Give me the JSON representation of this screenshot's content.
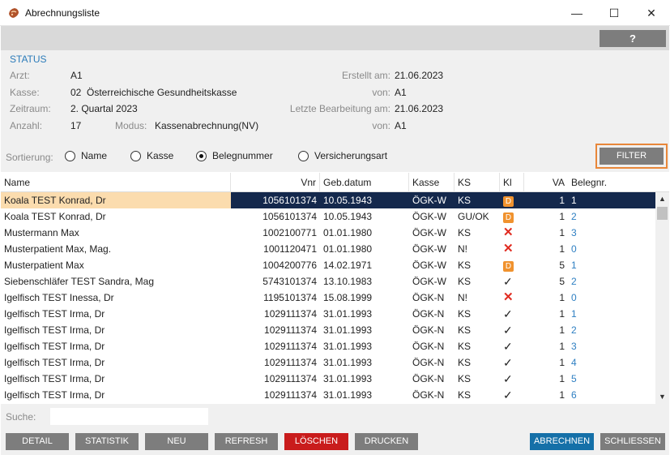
{
  "window": {
    "title": "Abrechnungsliste",
    "minimize": "—",
    "maximize": "☐",
    "close": "✕"
  },
  "help": {
    "label": "?"
  },
  "status": {
    "heading": "STATUS",
    "arzt_label": "Arzt:",
    "arzt_value": "A1",
    "kasse_label": "Kasse:",
    "kasse_value": "02  Österreichische Gesundheitskasse",
    "zeitraum_label": "Zeitraum:",
    "zeitraum_value": "2. Quartal 2023",
    "anzahl_label": "Anzahl:",
    "anzahl_value": "17",
    "modus_label": "Modus:",
    "modus_value": "Kassenabrechnung(NV)",
    "erstellt_label": "Erstellt am:",
    "erstellt_value": "21.06.2023",
    "von1_label": "von:",
    "von1_value": "A1",
    "letzte_label": "Letzte Bearbeitung am:",
    "letzte_value": "21.06.2023",
    "von2_label": "von:",
    "von2_value": "A1"
  },
  "sort": {
    "label": "Sortierung:",
    "options": [
      {
        "label": "Name",
        "selected": false
      },
      {
        "label": "Kasse",
        "selected": false
      },
      {
        "label": "Belegnummer",
        "selected": true
      },
      {
        "label": "Versicherungsart",
        "selected": false
      }
    ],
    "filter_label": "FILTER"
  },
  "table": {
    "headers": {
      "name": "Name",
      "vnr": "Vnr",
      "geb": "Geb.datum",
      "kasse": "Kasse",
      "ks": "KS",
      "kl": "Kl",
      "va": "VA",
      "belegnr": "Belegnr."
    },
    "rows": [
      {
        "name": "Koala TEST Konrad, Dr",
        "vnr": "1056101374",
        "geb": "10.05.1943",
        "kasse": "ÖGK-W",
        "ks": "KS",
        "kl": "badge",
        "va": "1",
        "belegnr": "1",
        "selected": true
      },
      {
        "name": "Koala TEST Konrad, Dr",
        "vnr": "1056101374",
        "geb": "10.05.1943",
        "kasse": "ÖGK-W",
        "ks": "GU/OK",
        "kl": "badge",
        "va": "1",
        "belegnr": "2",
        "selected": false
      },
      {
        "name": "Mustermann Max",
        "vnr": "1002100771",
        "geb": "01.01.1980",
        "kasse": "ÖGK-W",
        "ks": "KS",
        "kl": "x",
        "va": "1",
        "belegnr": "3",
        "selected": false
      },
      {
        "name": "Musterpatient Max, Mag.",
        "vnr": "1001120471",
        "geb": "01.01.1980",
        "kasse": "ÖGK-W",
        "ks": "N!",
        "kl": "x",
        "va": "1",
        "belegnr": "0",
        "selected": false
      },
      {
        "name": "Musterpatient Max",
        "vnr": "1004200776",
        "geb": "14.02.1971",
        "kasse": "ÖGK-W",
        "ks": "KS",
        "kl": "badge",
        "va": "5",
        "belegnr": "1",
        "selected": false
      },
      {
        "name": "Siebenschläfer TEST Sandra, Mag",
        "vnr": "5743101374",
        "geb": "13.10.1983",
        "kasse": "ÖGK-W",
        "ks": "KS",
        "kl": "check",
        "va": "5",
        "belegnr": "2",
        "selected": false
      },
      {
        "name": "Igelfisch TEST Inessa, Dr",
        "vnr": "1195101374",
        "geb": "15.08.1999",
        "kasse": "ÖGK-N",
        "ks": "N!",
        "kl": "x",
        "va": "1",
        "belegnr": "0",
        "selected": false
      },
      {
        "name": "Igelfisch TEST Irma, Dr",
        "vnr": "1029111374",
        "geb": "31.01.1993",
        "kasse": "ÖGK-N",
        "ks": "KS",
        "kl": "check",
        "va": "1",
        "belegnr": "1",
        "selected": false
      },
      {
        "name": "Igelfisch TEST Irma, Dr",
        "vnr": "1029111374",
        "geb": "31.01.1993",
        "kasse": "ÖGK-N",
        "ks": "KS",
        "kl": "check",
        "va": "1",
        "belegnr": "2",
        "selected": false
      },
      {
        "name": "Igelfisch TEST Irma, Dr",
        "vnr": "1029111374",
        "geb": "31.01.1993",
        "kasse": "ÖGK-N",
        "ks": "KS",
        "kl": "check",
        "va": "1",
        "belegnr": "3",
        "selected": false
      },
      {
        "name": "Igelfisch TEST Irma, Dr",
        "vnr": "1029111374",
        "geb": "31.01.1993",
        "kasse": "ÖGK-N",
        "ks": "KS",
        "kl": "check",
        "va": "1",
        "belegnr": "4",
        "selected": false
      },
      {
        "name": "Igelfisch TEST Irma, Dr",
        "vnr": "1029111374",
        "geb": "31.01.1993",
        "kasse": "ÖGK-N",
        "ks": "KS",
        "kl": "check",
        "va": "1",
        "belegnr": "5",
        "selected": false
      },
      {
        "name": "Igelfisch TEST Irma, Dr",
        "vnr": "1029111374",
        "geb": "31.01.1993",
        "kasse": "ÖGK-N",
        "ks": "KS",
        "kl": "check",
        "va": "1",
        "belegnr": "6",
        "selected": false
      }
    ],
    "badge_text": "D"
  },
  "search": {
    "label": "Suche:",
    "value": ""
  },
  "buttons": {
    "detail": "DETAIL",
    "statistik": "STATISTIK",
    "neu": "NEU",
    "refresh": "REFRESH",
    "loeschen": "LÖSCHEN",
    "drucken": "DRUCKEN",
    "abrechnen": "ABRECHNEN",
    "schliessen": "SCHLIESSEN"
  }
}
